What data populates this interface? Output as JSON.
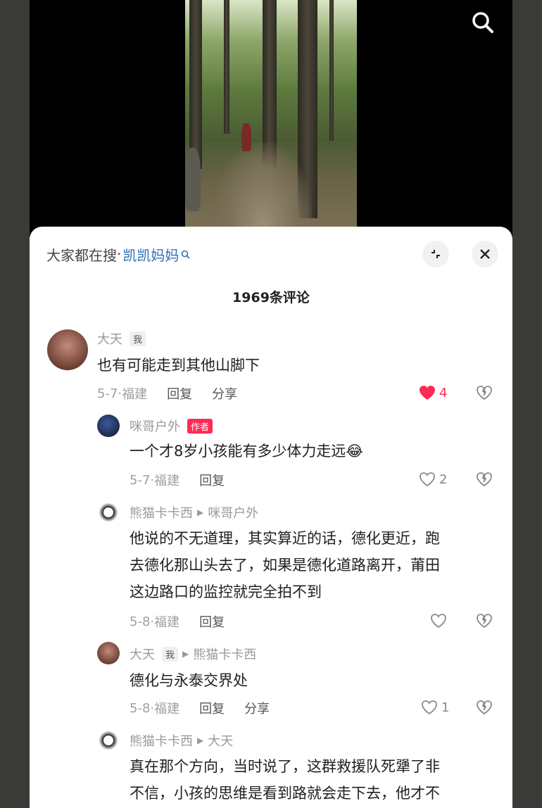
{
  "top_search_icon": "search-icon",
  "panel": {
    "search_label": "大家都在搜",
    "search_sep": "·",
    "search_keyword": "凯凯妈妈",
    "comment_count_label": "1969条评论"
  },
  "comments": [
    {
      "user": "大天",
      "badge": "我",
      "reply_to": "",
      "text_lines": [
        "也有可能走到其他山脚下"
      ],
      "date": "5-7",
      "location": "福建",
      "reply_label": "回复",
      "share_label": "分享",
      "likes": "4",
      "liked": true
    },
    {
      "user": "咪哥户外",
      "badge": "作者",
      "reply_to": "",
      "text_lines": [
        "一个才8岁小孩能有多少体力走远😂"
      ],
      "date": "5-7",
      "location": "福建",
      "reply_label": "回复",
      "share_label": "",
      "likes": "2",
      "liked": false
    },
    {
      "user": "熊猫卡卡西",
      "badge": "",
      "reply_to": "咪哥户外",
      "text_lines": [
        "他说的不无道理，其实算近的话，德化更近，跑",
        "去德化那山头去了，如果是德化道路离开，莆田",
        "这边路口的监控就完全拍不到"
      ],
      "date": "5-8",
      "location": "福建",
      "reply_label": "回复",
      "share_label": "",
      "likes": "",
      "liked": false
    },
    {
      "user": "大天",
      "badge": "我",
      "reply_to": "熊猫卡卡西",
      "text_lines": [
        "德化与永泰交界处"
      ],
      "date": "5-8",
      "location": "福建",
      "reply_label": "回复",
      "share_label": "分享",
      "likes": "1",
      "liked": false
    },
    {
      "user": "熊猫卡卡西",
      "badge": "",
      "reply_to": "大天",
      "text_lines": [
        "真在那个方向，当时说了，这群救援队死犟了非",
        "不信，小孩的思维是看到路就会走下去，他才不"
      ],
      "date": "",
      "location": "",
      "reply_label": "",
      "share_label": "",
      "likes": "",
      "liked": false
    }
  ],
  "colors": {
    "like_red": "#fd2c55",
    "link_blue": "#2e6fb5",
    "author_tag": "#fd2c55"
  }
}
